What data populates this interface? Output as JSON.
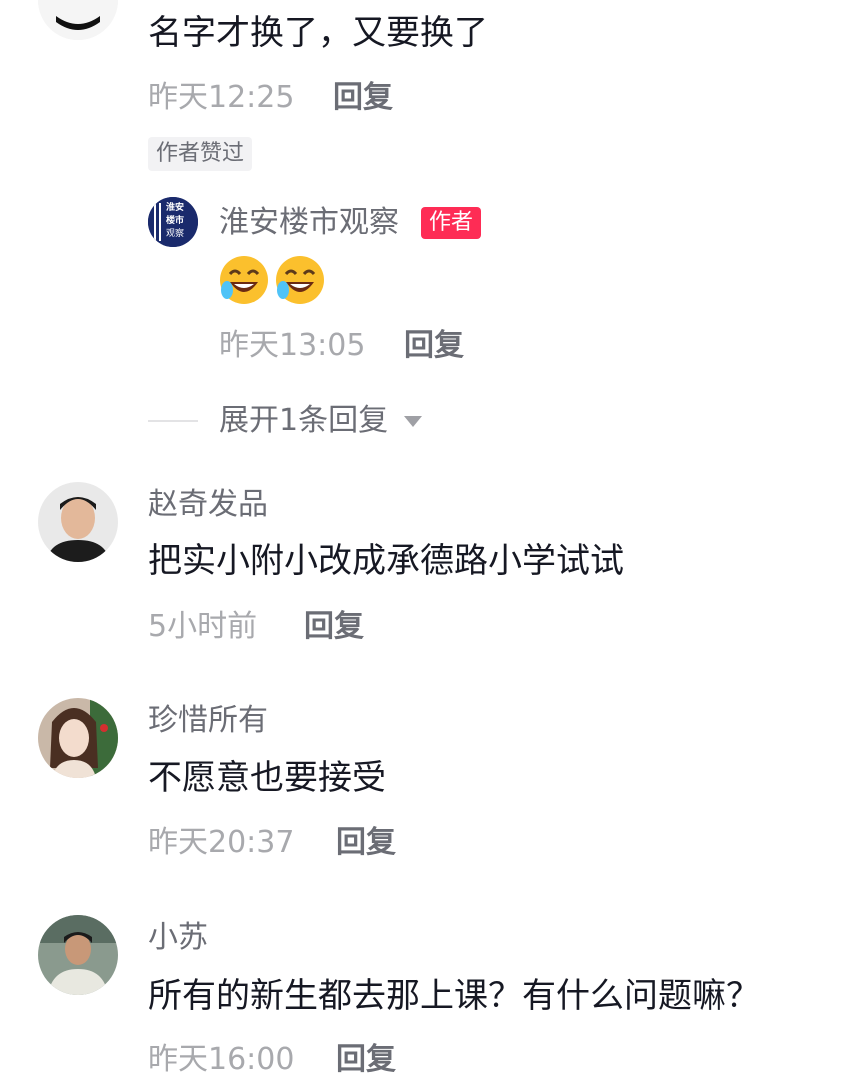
{
  "comments": [
    {
      "text": "名字才换了，又要换了",
      "time": "昨天12:25",
      "reply_label": "回复",
      "liked_label": "作者赞过"
    },
    {
      "author": "淮安楼市观察",
      "author_badge": "作者",
      "avatar_text": [
        "淮安",
        "楼市",
        "观察"
      ],
      "emoji": "🤣🤣",
      "time": "昨天13:05",
      "reply_label": "回复"
    },
    {
      "author": "赵奇发品",
      "text": "把实小附小改成承德路小学试试",
      "time": "5小时前",
      "reply_label": "回复"
    },
    {
      "author": "珍惜所有",
      "text": "不愿意也要接受",
      "time": "昨天20:37",
      "reply_label": "回复"
    },
    {
      "author": "小苏",
      "text": "所有的新生都去那上课？有什么问题嘛？",
      "time": "昨天16:00",
      "reply_label": "回复"
    }
  ],
  "expand_replies": "展开1条回复",
  "colors": {
    "name": "#6b6d75",
    "text": "#161823",
    "time": "#a8a9ad",
    "author_badge": "#fe2c55",
    "avatar_navy": "#1a2a6c"
  }
}
